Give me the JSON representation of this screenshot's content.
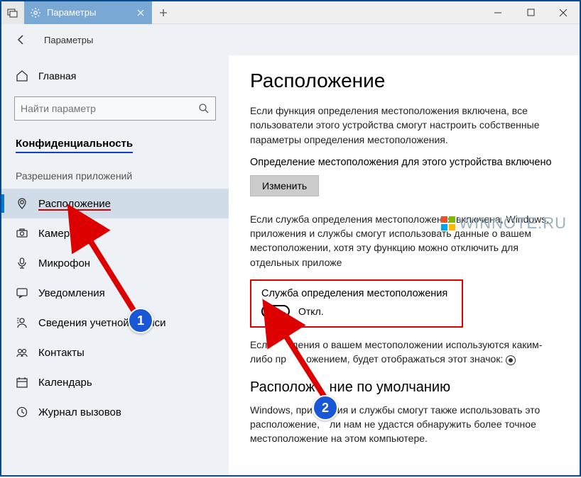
{
  "titlebar": {
    "tab_title": "Параметры"
  },
  "header": {
    "title": "Параметры"
  },
  "sidebar": {
    "home": "Главная",
    "search_placeholder": "Найти параметр",
    "privacy_header": "Конфиденциальность",
    "category": "Разрешения приложений",
    "items": [
      {
        "label": "Расположение",
        "icon": "location"
      },
      {
        "label": "Камера",
        "icon": "camera"
      },
      {
        "label": "Микрофон",
        "icon": "microphone"
      },
      {
        "label": "Уведомления",
        "icon": "notifications"
      },
      {
        "label": "Сведения учетной записи",
        "icon": "account"
      },
      {
        "label": "Контакты",
        "icon": "contacts"
      },
      {
        "label": "Календарь",
        "icon": "calendar"
      },
      {
        "label": "Журнал вызовов",
        "icon": "callhistory"
      }
    ]
  },
  "content": {
    "heading": "Расположение",
    "para1": "Если функция определения местоположения включена, все пользователи этого устройства смогут настроить собственные параметры определения местоположения.",
    "device_status": "Определение местоположения для этого устройства включено",
    "change_btn": "Изменить",
    "para2_pre": "Если служба определения местоположения включена, Windows, приложения и службы смогут использовать данные о вашем местоположении, хотя эту функцию можно отключить для отдельных приложе",
    "feature_label": "Служба определения местоположения",
    "toggle_state": "Откл.",
    "para3_pre": "Есл",
    "para3_mid": "дения о вашем местоположении используются каким-либо пр",
    "para3_post": "ожением, будет отображаться этот значок:",
    "section2": "Располож",
    "section2_post": "ние по умолчанию",
    "para4_a": "Windows, при",
    "para4_b": "ия и службы смогут также использовать это расположение,",
    "para4_c": "ли нам не удастся обнаружить более точное местоположение на этом компьютере."
  },
  "watermark": "WINNOTE.RU",
  "annotations": {
    "badge1": "1",
    "badge2": "2"
  }
}
